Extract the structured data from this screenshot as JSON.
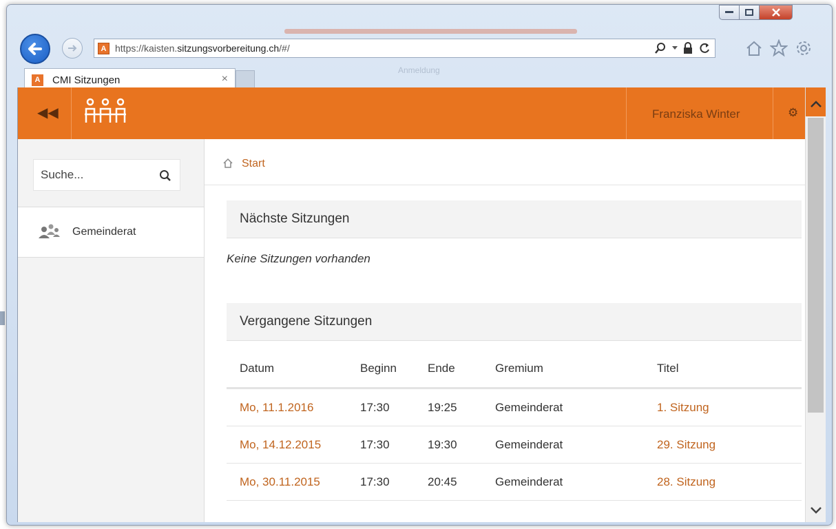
{
  "browser": {
    "url_prefix": "https://kaisten.",
    "url_domain": "sitzungsvorbereitung.ch",
    "url_suffix": "/#/",
    "tab_title": "CMI Sitzungen",
    "tab_close": "×",
    "favicon_letter": "A",
    "background_text": "Anmeldung"
  },
  "header": {
    "user_name": "Franziska Winter"
  },
  "sidebar": {
    "search_placeholder": "Suche...",
    "items": [
      {
        "label": "Gemeinderat",
        "icon": "users-icon"
      }
    ]
  },
  "breadcrumb": {
    "label": "Start"
  },
  "next_meetings": {
    "title": "Nächste Sitzungen",
    "empty_text": "Keine Sitzungen vorhanden"
  },
  "past_meetings": {
    "title": "Vergangene Sitzungen",
    "columns": [
      "Datum",
      "Beginn",
      "Ende",
      "Gremium",
      "Titel"
    ],
    "rows": [
      {
        "datum": "Mo, 11.1.2016",
        "beginn": "17:30",
        "ende": "19:25",
        "gremium": "Gemeinderat",
        "titel": "1. Sitzung"
      },
      {
        "datum": "Mo, 14.12.2015",
        "beginn": "17:30",
        "ende": "19:30",
        "gremium": "Gemeinderat",
        "titel": "29. Sitzung"
      },
      {
        "datum": "Mo, 30.11.2015",
        "beginn": "17:30",
        "ende": "20:45",
        "gremium": "Gemeinderat",
        "titel": "28. Sitzung"
      }
    ]
  },
  "colors": {
    "accent": "#e8741f",
    "link": "#c0641e"
  }
}
